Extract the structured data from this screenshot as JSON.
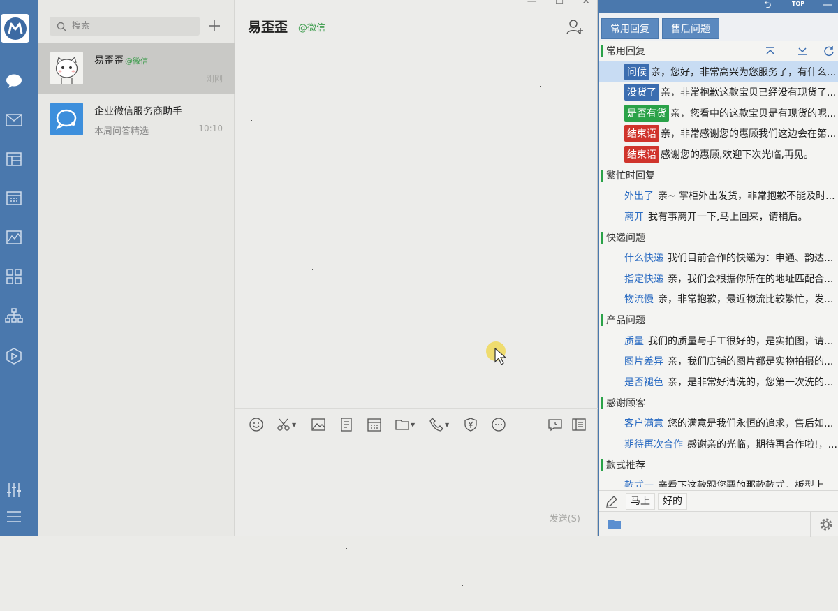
{
  "search": {
    "placeholder": "搜索"
  },
  "conversations": [
    {
      "name": "易歪歪",
      "tag": "@微信",
      "preview": "",
      "time": "刚刚"
    },
    {
      "name": "企业微信服务商助手",
      "tag": "",
      "preview": "本周问答精选",
      "time": "10:10"
    }
  ],
  "chat": {
    "title": "易歪歪",
    "tag": "@微信",
    "send_label": "发送(S)"
  },
  "quick_reply": {
    "tabs": [
      "常用回复",
      "售后问题"
    ],
    "categories": [
      {
        "title": "常用回复",
        "items": [
          {
            "label": "问候",
            "text": "亲，您好，非常高兴为您服务了，有什么...",
            "color": "#3b6db0",
            "badge": true
          },
          {
            "label": "没货了",
            "text": "亲，非常抱歉这款宝贝已经没有现货了...",
            "color": "#3b6db0",
            "badge": true
          },
          {
            "label": "是否有货",
            "text": "亲，您看中的这款宝贝是有现货的呢...",
            "color": "#2aa248",
            "badge": true
          },
          {
            "label": "结束语",
            "text": "亲，非常感谢您的惠顾我们这边会在第...",
            "color": "#d0342c",
            "badge": true
          },
          {
            "label": "结束语",
            "text": "感谢您的惠顾,欢迎下次光临,再见。",
            "color": "#d0342c",
            "badge": true
          }
        ]
      },
      {
        "title": "繁忙时回复",
        "items": [
          {
            "label": "外出了",
            "text": "亲~ 掌柜外出发货，非常抱歉不能及时...",
            "badge": false
          },
          {
            "label": "离开",
            "text": "我有事离开一下,马上回来，请稍后。",
            "badge": false
          }
        ]
      },
      {
        "title": "快递问题",
        "items": [
          {
            "label": "什么快递",
            "text": "我们目前合作的快递为：申通、韵达...",
            "badge": false
          },
          {
            "label": "指定快递",
            "text": "亲，我们会根据你所在的地址匹配合...",
            "badge": false
          },
          {
            "label": "物流慢",
            "text": "亲，非常抱歉，最近物流比较繁忙，发...",
            "badge": false
          }
        ]
      },
      {
        "title": "产品问题",
        "items": [
          {
            "label": "质量",
            "text": "我们的质量与手工很好的，是实拍图，请...",
            "badge": false
          },
          {
            "label": "图片差异",
            "text": "亲，我们店铺的图片都是实物拍摄的...",
            "badge": false
          },
          {
            "label": "是否褪色",
            "text": "亲，是非常好清洗的，您第一次洗的...",
            "badge": false
          }
        ]
      },
      {
        "title": "感谢顾客",
        "items": [
          {
            "label": "客户满意",
            "text": "您的满意是我们永恒的追求，售后如...",
            "badge": false
          },
          {
            "label": "期待再次合作",
            "text": "感谢亲的光临，期待再合作啦!，...",
            "badge": false
          }
        ]
      },
      {
        "title": "款式推荐",
        "items": [
          {
            "label": "款式一",
            "text": "亲看下这款跟您要的那款款式，板型上...",
            "badge": false
          }
        ]
      }
    ],
    "quick_words": [
      "马上",
      "好的"
    ],
    "top_label": "TOP"
  },
  "colors": {
    "nav": "#4a78ad",
    "accent_green": "#2aa248",
    "badge_blue": "#3b6db0",
    "badge_red": "#d0342c"
  }
}
